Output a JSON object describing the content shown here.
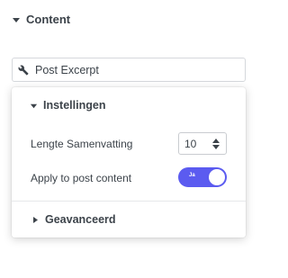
{
  "section": {
    "title": "Content",
    "icon": "caret-down-icon"
  },
  "field": {
    "value": "Post Excerpt",
    "icon": "wrench-icon"
  },
  "popover": {
    "settings_title": "Instellingen",
    "rows": [
      {
        "label": "Lengte Samenvatting",
        "value": "10"
      },
      {
        "label": "Apply to post content",
        "toggle_text": "Ja",
        "toggle_on": true
      }
    ],
    "advanced_title": "Geavanceerd"
  },
  "colors": {
    "accent": "#5b5bf0",
    "text": "#3c434a",
    "border": "#d5d8dc"
  }
}
